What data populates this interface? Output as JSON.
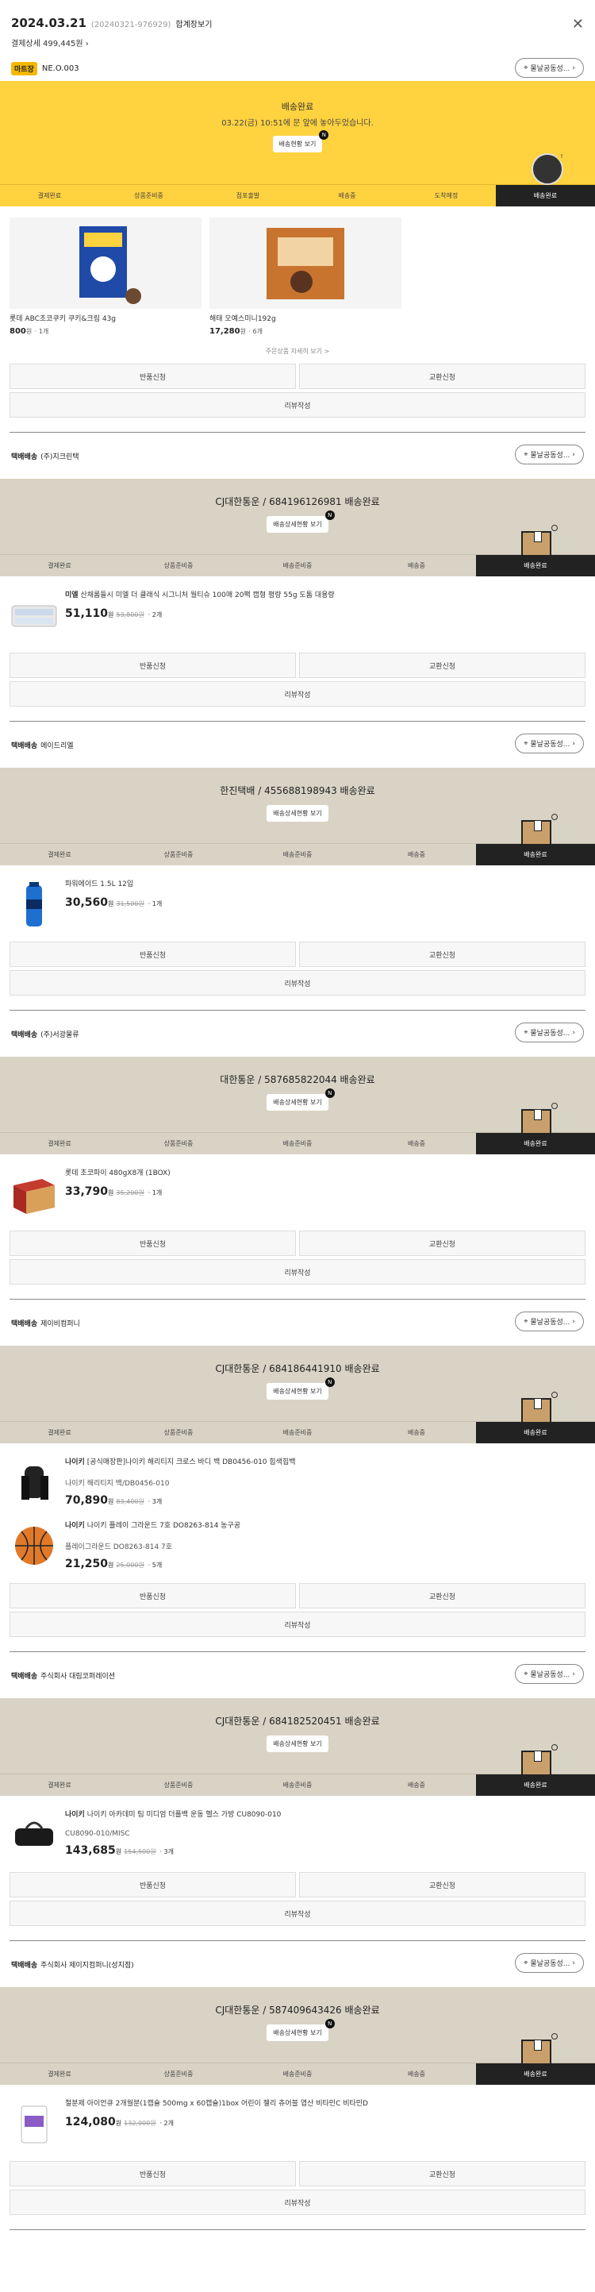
{
  "header": {
    "date": "2024.03.21",
    "order_no": "(20240321-976929)",
    "total_label": "합계장보기",
    "payment": "결제상세 499,445원",
    "close_icon": "close-icon"
  },
  "mart": {
    "badge": "마트장",
    "store": "NE.O.003",
    "return_btn": "물날공동성..."
  },
  "mart_banner": {
    "title": "배송완료",
    "sub": "03.22(금) 10:51에 문 앞에 놓아두었습니다.",
    "btn": "배송현황 보기",
    "steps": [
      "결제완료",
      "상품준비중",
      "점포출발",
      "배송중",
      "도착예정",
      "배송완료"
    ]
  },
  "mart_products": [
    {
      "name": "롯데 ABC초코쿠키 쿠키&크림 43g",
      "price": "800",
      "won": "원",
      "qty": "· 1개"
    },
    {
      "name": "해태 오예스미니192g",
      "price": "17,280",
      "won": "원",
      "qty": "· 6개"
    }
  ],
  "more_label": "주문상품 자세히 보기 >",
  "action_labels": {
    "return": "반품신청",
    "exchange": "교환신청",
    "review": "리뷰작성"
  },
  "sections": [
    {
      "kind": "택배배송",
      "seller": "(주)지크린택",
      "return_btn": "물날공동성...",
      "tracking": "CJ대한통운 / 684196126981 배송완료",
      "tracking_btn": "배송상세현황 보기",
      "steps": [
        "결제완료",
        "상품준비중",
        "배송준비중",
        "배송중",
        "배송완료"
      ],
      "items": [
        {
          "brand": "미엘",
          "name": "산채롬들시 미엘 더 클래식 시그니처 월티슈 100매 20팩 캡형 평량 55g 도톰 대용량",
          "option": "",
          "price": "51,110",
          "won": "원",
          "orig": "53,800원",
          "qty": "· 2개",
          "icon": "wipes-icon"
        }
      ]
    },
    {
      "kind": "택배배송",
      "seller": "에이드리엘",
      "return_btn": "물날공동성...",
      "tracking": "한진택배 / 455688198943 배송완료",
      "tracking_btn": "배송상세현황 보기",
      "steps": [
        "결제완료",
        "상품준비중",
        "배송준비중",
        "배송중",
        "배송완료"
      ],
      "items": [
        {
          "brand": "",
          "name": "파워에이드 1.5L 12입",
          "option": "",
          "price": "30,560",
          "won": "원",
          "orig": "31,500원",
          "qty": "· 1개",
          "icon": "bottle-icon"
        }
      ]
    },
    {
      "kind": "택배배송",
      "seller": "(주)서광물류",
      "return_btn": "물날공동성...",
      "tracking": "대한통운 / 587685822044 배송완료",
      "tracking_btn": "배송상세현황 보기",
      "steps": [
        "결제완료",
        "상품준비중",
        "배송준비중",
        "배송중",
        "배송완료"
      ],
      "items": [
        {
          "brand": "",
          "name": "롯데 초코파이 480gX8개 (1BOX)",
          "option": "",
          "price": "33,790",
          "won": "원",
          "orig": "35,200원",
          "qty": "· 1개",
          "icon": "box-icon"
        }
      ]
    },
    {
      "kind": "택배배송",
      "seller": "제이비컴퍼니",
      "return_btn": "물날공동성...",
      "tracking": "CJ대한통운 / 684186441910 배송완료",
      "tracking_btn": "배송상세현황 보기",
      "steps": [
        "결제완료",
        "상품준비중",
        "배송준비중",
        "배송중",
        "배송완료"
      ],
      "items": [
        {
          "brand": "나이키",
          "name": "[공식매장판]나이키 해리티지 크로스 바디 백 DB0456-010 힙색힙백",
          "option": "나이키 해리티지 백/DB0456-010",
          "price": "70,890",
          "won": "원",
          "orig": "83,400원",
          "qty": "· 3개",
          "icon": "bag-icon"
        },
        {
          "brand": "나이키",
          "name": "나이키 플레이 그라운드 7호 DO8263-814 농구공",
          "option": "플레이그라운드 DO8263-814 7호",
          "price": "21,250",
          "won": "원",
          "orig": "25,000원",
          "qty": "· 5개",
          "icon": "ball-icon"
        }
      ]
    },
    {
      "kind": "택배배송",
      "seller": "주식회사 대림코퍼레이션",
      "return_btn": "물날공동성...",
      "tracking": "CJ대한통운 / 684182520451 배송완료",
      "tracking_btn": "배송상세현황 보기",
      "steps": [
        "결제완료",
        "상품준비중",
        "배송준비중",
        "배송중",
        "배송완료"
      ],
      "items": [
        {
          "brand": "나이키",
          "name": "나이키 아카데미 팀 미디엄 더플백 운동 헬스 가방 CU8090-010",
          "option": "CU8090-010/MISC",
          "price": "143,685",
          "won": "원",
          "orig": "154,500원",
          "qty": "· 3개",
          "icon": "duffel-icon"
        }
      ]
    },
    {
      "kind": "택배배송",
      "seller": "주식회사 제이지컴퍼니(성지점)",
      "return_btn": "물날공동성...",
      "tracking": "CJ대한통운 / 587409643426 배송완료",
      "tracking_btn": "배송상세현황 보기",
      "steps": [
        "결제완료",
        "상품준비중",
        "배송준비중",
        "배송중",
        "배송완료"
      ],
      "items": [
        {
          "brand": "",
          "name": "철분제 아이언큐 2개월분(1캡슐 500mg x 60캡슐)1box 어린이 젤리 츄어블 엽산 비타민C 비타민D",
          "option": "",
          "price": "124,080",
          "won": "원",
          "orig": "132,000원",
          "qty": "· 2개",
          "icon": "supplement-icon"
        }
      ]
    }
  ]
}
